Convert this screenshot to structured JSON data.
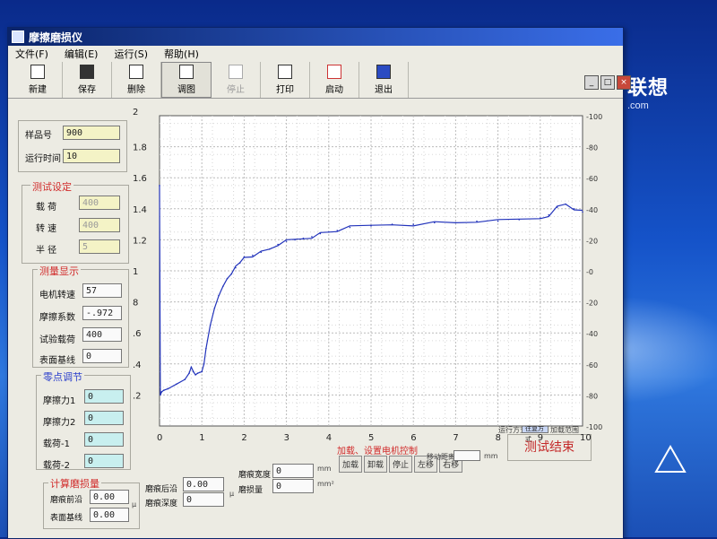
{
  "window": {
    "title": "摩擦磨损仪"
  },
  "menu": {
    "file": "文件(F)",
    "edit": "编辑(E)",
    "run": "运行(S)",
    "help": "帮助(H)"
  },
  "toolbar": {
    "new": "新建",
    "save": "保存",
    "delete": "删除",
    "view": "调图",
    "stop": "停止",
    "print": "打印",
    "start": "启动",
    "exit": "退出"
  },
  "sample": {
    "id_label": "样品号",
    "id_value": "900",
    "time_label": "运行时间",
    "time_value": "10"
  },
  "test_setting": {
    "title": "测试设定",
    "load_label": "载 荷",
    "load_value": "400",
    "speed_label": "转 速",
    "speed_value": "400",
    "radius_label": "半 径",
    "radius_value": "5"
  },
  "measure": {
    "title": "测量显示",
    "motor_label": "电机转速",
    "motor_value": "57",
    "friction_label": "摩擦系数",
    "friction_value": "-.972",
    "load_label": "试验载荷",
    "load_value": "400",
    "baseline_label": "表面基线",
    "baseline_value": "0"
  },
  "zero": {
    "title": "零点调节",
    "f1_label": "摩擦力1",
    "f1_value": "0",
    "f2_label": "摩擦力2",
    "f2_value": "0",
    "l1_label": "载荷-1",
    "l1_value": "0",
    "l2_label": "载荷-2",
    "l2_value": "0"
  },
  "wear": {
    "title": "计算磨损量",
    "front_label": "磨痕前沿",
    "front_value": "0.00",
    "surface_label": "表面基线",
    "surface_value": "0.00",
    "back_label": "磨痕后沿",
    "back_value": "0.00",
    "depth_label": "磨痕深度",
    "depth_value": "0",
    "width_label": "磨痕宽度",
    "width_value": "0",
    "amount_label": "磨损量",
    "amount_value": "0",
    "unit_mm": "mm",
    "unit_mm2": "mm²",
    "unit_mu": "μ"
  },
  "controls": {
    "motor_note": "加载、设置电机控制",
    "btn_load": "加载",
    "btn_unload": "卸载",
    "btn_stop": "停止",
    "btn_left": "左移",
    "btn_right": "右移",
    "move_label": "移动距离",
    "move_unit": "mm",
    "mode_label": "运行方式",
    "mode_value": "往复方式",
    "load_range_label": "加载范围",
    "end_button": "测试结束"
  },
  "desktop": {
    "brand": "联想",
    "brand_sub": ".com"
  },
  "chart_data": {
    "type": "line",
    "xlim": [
      0,
      10
    ],
    "ylim": [
      0,
      2
    ],
    "x_ticks": [
      "0",
      "1",
      "2",
      "3",
      "4",
      "5",
      "6",
      "7",
      "8",
      "9",
      "10"
    ],
    "y_ticks": [
      "1.8",
      "1.6",
      "1.4",
      "1.2",
      "1",
      "8",
      ".6",
      ".4",
      ".2"
    ],
    "y_top_label": "2",
    "right_ticks": [
      "100",
      "80",
      "60",
      "40",
      "20",
      "0",
      "20",
      "40",
      "60",
      "80",
      "100"
    ],
    "grid": true,
    "series": [
      {
        "color": "#2233bb",
        "x": [
          0,
          0.02,
          0.05,
          0.1,
          0.2,
          0.4,
          0.6,
          0.7,
          0.75,
          0.8,
          0.85,
          0.9,
          1.0,
          1.05,
          1.1,
          1.2,
          1.3,
          1.4,
          1.5,
          1.6,
          1.7,
          1.8,
          1.9,
          2.0,
          2.2,
          2.4,
          2.6,
          2.8,
          3.0,
          3.2,
          3.4,
          3.6,
          3.8,
          4.0,
          4.2,
          4.5,
          5.0,
          5.5,
          6.0,
          6.5,
          7.0,
          7.5,
          8.0,
          8.5,
          9.0,
          9.2,
          9.4,
          9.6,
          9.8,
          10.0
        ],
        "y": [
          1.55,
          0.2,
          0.22,
          0.23,
          0.24,
          0.27,
          0.3,
          0.34,
          0.38,
          0.35,
          0.33,
          0.34,
          0.35,
          0.4,
          0.5,
          0.65,
          0.76,
          0.84,
          0.9,
          0.95,
          0.98,
          1.02,
          1.05,
          1.09,
          1.1,
          1.12,
          1.14,
          1.17,
          1.19,
          1.2,
          1.21,
          1.22,
          1.24,
          1.25,
          1.26,
          1.28,
          1.29,
          1.3,
          1.3,
          1.31,
          1.31,
          1.32,
          1.32,
          1.33,
          1.34,
          1.36,
          1.41,
          1.43,
          1.4,
          1.38
        ]
      }
    ]
  }
}
